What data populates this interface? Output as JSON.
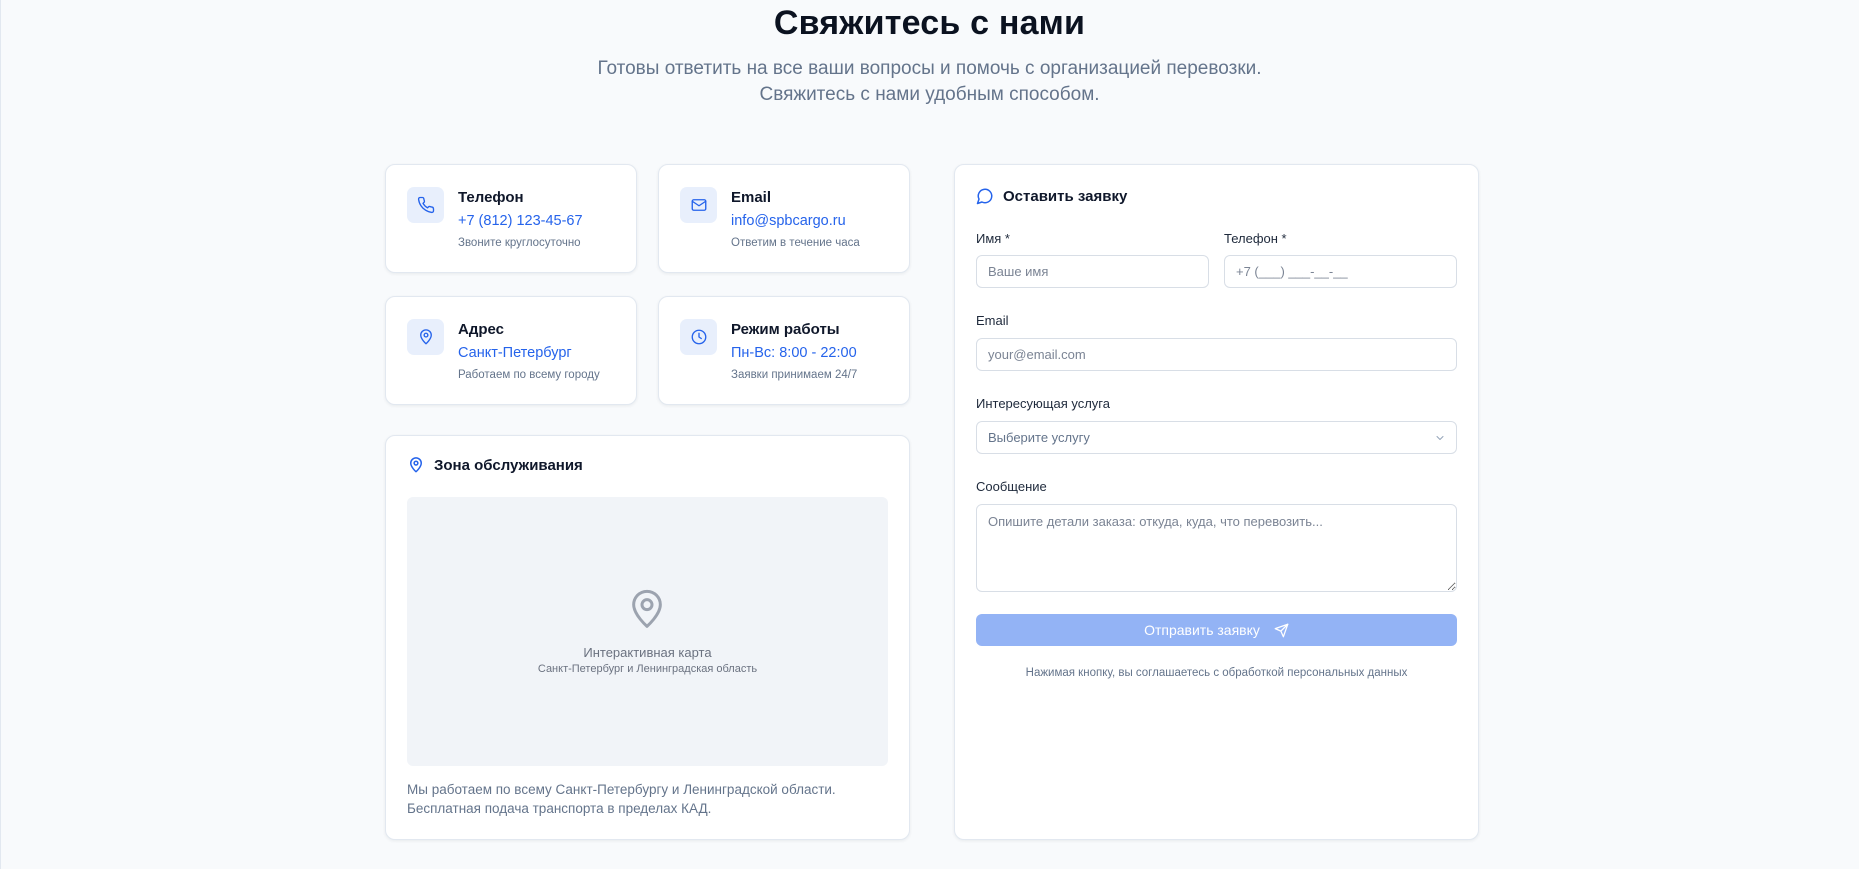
{
  "header": {
    "title": "Свяжитесь с нами",
    "subtitle_line1": "Готовы ответить на все ваши вопросы и помочь с организацией перевозки.",
    "subtitle_line2": "Свяжитесь с нами удобным способом."
  },
  "contacts": {
    "phone": {
      "icon": "phone-icon",
      "title": "Телефон",
      "value": "+7 (812) 123-45-67",
      "note": "Звоните круглосуточно"
    },
    "email": {
      "icon": "mail-icon",
      "title": "Email",
      "value": "info@spbcargo.ru",
      "note": "Ответим в течение часа"
    },
    "address": {
      "icon": "map-pin-icon",
      "title": "Адрес",
      "value": "Санкт-Петербург",
      "note": "Работаем по всему городу"
    },
    "hours": {
      "icon": "clock-icon",
      "title": "Режим работы",
      "value": "Пн-Вс: 8:00 - 22:00",
      "note": "Заявки принимаем 24/7"
    }
  },
  "zone": {
    "title": "Зона обслуживания",
    "map_title": "Интерактивная карта",
    "map_subtitle": "Санкт-Петербург и Ленинградская область",
    "text_line1": "Мы работаем по всему Санкт-Петербургу и Ленинградской области.",
    "text_line2": "Бесплатная подача транспорта в пределах КАД."
  },
  "form": {
    "title": "Оставить заявку",
    "name_label": "Имя *",
    "name_placeholder": "Ваше имя",
    "phone_label": "Телефон *",
    "phone_placeholder": "+7 (___) ___-__-__",
    "email_label": "Email",
    "email_placeholder": "your@email.com",
    "service_label": "Интересующая услуга",
    "service_placeholder": "Выберите услугу",
    "message_label": "Сообщение",
    "message_placeholder": "Опишите детали заказа: откуда, куда, что перевозить...",
    "submit_label": "Отправить заявку",
    "consent": "Нажимая кнопку, вы соглашаетесь с обработкой персональных данных"
  },
  "colors": {
    "accent": "#2563eb",
    "icon_bg": "#e8effc",
    "button_disabled": "#93b3f5",
    "page_bg": "#f8fafc"
  }
}
